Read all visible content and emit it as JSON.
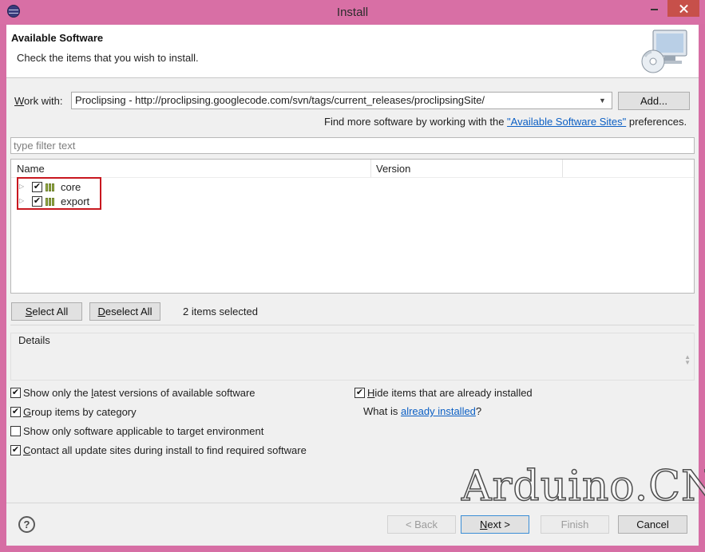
{
  "window": {
    "title": "Install",
    "accent_color": "#d86fa5"
  },
  "header": {
    "title": "Available Software",
    "description": "Check the items that you wish to install."
  },
  "work_with": {
    "label": "Work with:",
    "value": "Proclipsing - http://proclipsing.googlecode.com/svn/tags/current_releases/proclipsingSite/",
    "add_button": "Add..."
  },
  "more_software": {
    "prefix": "Find more software by working with the ",
    "link": "\"Available Software Sites\"",
    "suffix": " preferences."
  },
  "filter": {
    "placeholder": "type filter text"
  },
  "tree": {
    "columns": [
      "Name",
      "Version"
    ],
    "items": [
      {
        "label": "core",
        "checked": true,
        "icon": "package-icon"
      },
      {
        "label": "export",
        "checked": true,
        "icon": "package-icon"
      }
    ],
    "highlight_color": "#c8171f"
  },
  "selection": {
    "select_all": "Select All",
    "deselect_all": "Deselect All",
    "count_text": "2 items selected"
  },
  "details": {
    "label": "Details"
  },
  "options": {
    "latest_versions": "Show only the latest versions of available software",
    "group_by_category": "Group items by category",
    "applicable_only": "Show only software applicable to target environment",
    "contact_sites": "Contact all update sites during install to find required software",
    "hide_installed": "Hide items that are already installed",
    "what_is_prefix": "What is ",
    "what_is_link": "already installed",
    "what_is_suffix": "?"
  },
  "buttons": {
    "help": "?",
    "back": "< Back",
    "next": "Next >",
    "finish": "Finish",
    "cancel": "Cancel"
  },
  "watermark": "Arduino.CN",
  "checkmark": "✔"
}
